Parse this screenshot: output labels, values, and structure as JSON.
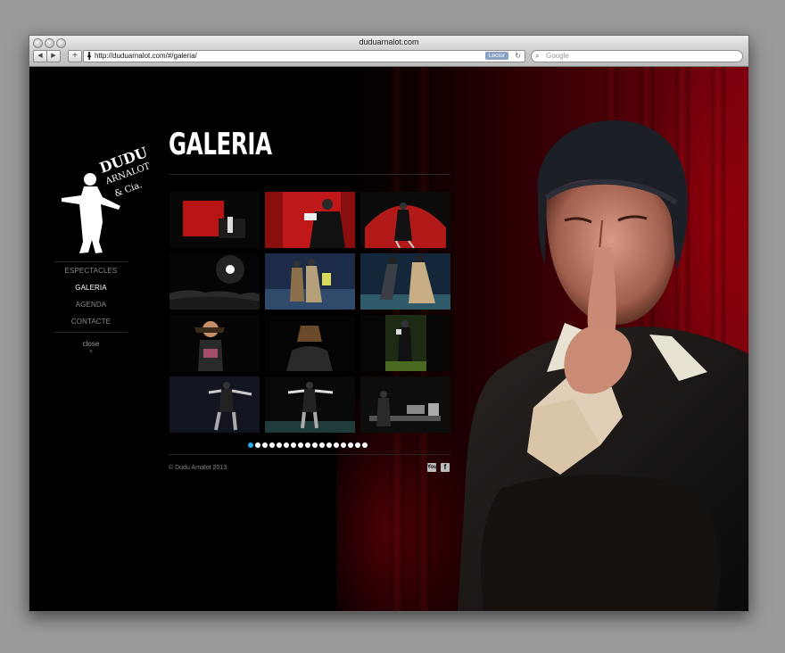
{
  "browser": {
    "window_title": "duduarnalot.com",
    "url": "http://duduarnalot.com/#/galeria/",
    "reader_label": "Lector",
    "search_placeholder": "Google",
    "back_glyph": "◀",
    "forward_glyph": "▶",
    "add_glyph": "+",
    "reload_glyph": "↻",
    "search_glyph": "⌕"
  },
  "site": {
    "logo": {
      "line1": "DUDU",
      "line2": "ARNALOT",
      "line3": "& Cia."
    },
    "nav": [
      {
        "label": "ESPECTACLES",
        "active": false
      },
      {
        "label": "GALERIA",
        "active": true
      },
      {
        "label": "AGENDA",
        "active": false
      },
      {
        "label": "CONTACTE",
        "active": false
      }
    ],
    "close_label": "close",
    "close_glyph": "×",
    "gallery_title": "GALERIA",
    "thumbnails": [
      {
        "scene": "red-curtain-stage"
      },
      {
        "scene": "red-curtain-performer"
      },
      {
        "scene": "red-curtain-arch"
      },
      {
        "scene": "audience-spotlight"
      },
      {
        "scene": "two-performers-blue"
      },
      {
        "scene": "two-performers-dance"
      },
      {
        "scene": "binoculars"
      },
      {
        "scene": "performer-hat"
      },
      {
        "scene": "performer-standing"
      },
      {
        "scene": "performer-arms-out"
      },
      {
        "scene": "performer-arms-out-2"
      },
      {
        "scene": "stage-props"
      }
    ],
    "pagination": {
      "total": 17,
      "current": 1
    },
    "copyright": "© Dudu Arnalot 2013",
    "social": [
      {
        "name": "youtube-icon",
        "glyph": "You"
      },
      {
        "name": "facebook-icon",
        "glyph": "f"
      }
    ],
    "accent_color": "#2aa7e6"
  }
}
